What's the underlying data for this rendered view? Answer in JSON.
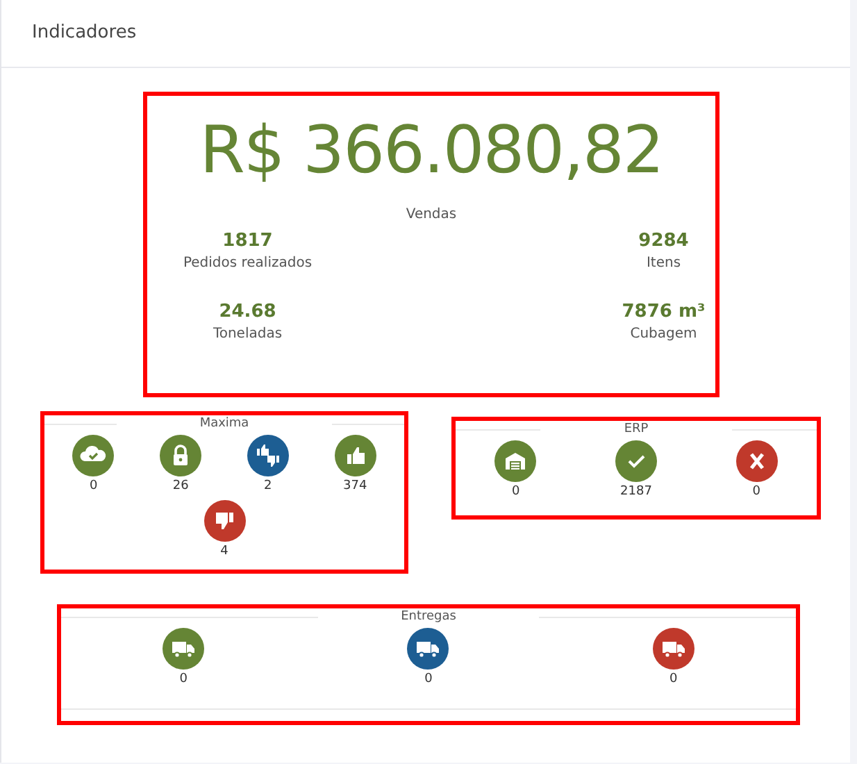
{
  "header": {
    "title": "Indicadores"
  },
  "summary": {
    "total": "R$ 366.080,82",
    "total_label": "Vendas",
    "stats": [
      {
        "value": "1817",
        "label": "Pedidos realizados"
      },
      {
        "value": "9284",
        "label": "Itens"
      },
      {
        "value": "24.68",
        "label": "Toneladas"
      },
      {
        "value": "7876 m³",
        "label": "Cubagem"
      }
    ]
  },
  "maxima": {
    "title": "Maxima",
    "items": [
      {
        "kind": "cloud-check",
        "color": "#658535",
        "count": "0"
      },
      {
        "kind": "lock",
        "color": "#658535",
        "count": "26"
      },
      {
        "kind": "thumbs-mixed",
        "color": "#1d5e93",
        "count": "2"
      },
      {
        "kind": "thumb-up",
        "color": "#658535",
        "count": "374"
      },
      {
        "kind": "thumb-down",
        "color": "#c0392b",
        "count": "4"
      }
    ]
  },
  "erp": {
    "title": "ERP",
    "items": [
      {
        "kind": "warehouse",
        "color": "#658535",
        "count": "0"
      },
      {
        "kind": "check",
        "color": "#658535",
        "count": "2187"
      },
      {
        "kind": "x",
        "color": "#c0392b",
        "count": "0"
      }
    ]
  },
  "entregas": {
    "title": "Entregas",
    "items": [
      {
        "kind": "truck",
        "color": "#658535",
        "count": "0"
      },
      {
        "kind": "truck",
        "color": "#1d5e93",
        "count": "0"
      },
      {
        "kind": "truck",
        "color": "#c0392b",
        "count": "0"
      }
    ]
  }
}
